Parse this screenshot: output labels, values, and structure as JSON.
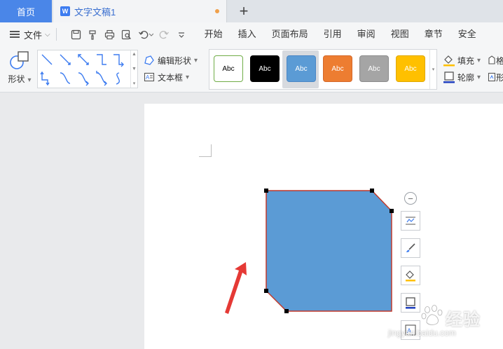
{
  "tabs": {
    "home_label": "首页",
    "doc_icon_letter": "W",
    "doc_title": "文字文稿1",
    "add_tab_symbol": "+"
  },
  "menu": {
    "file_label": "文件",
    "ribbon_tabs": [
      "开始",
      "插入",
      "页面布局",
      "引用",
      "审阅",
      "视图",
      "章节",
      "安全"
    ]
  },
  "ribbon": {
    "shape_label": "形状",
    "edit_shape_label": "编辑形状",
    "text_box_label": "文本框",
    "style_samples": [
      {
        "text": "Abc",
        "bg": "#ffffff",
        "border": "#70ad47",
        "fg": "#000000"
      },
      {
        "text": "Abc",
        "bg": "#000000",
        "border": "#000000",
        "fg": "#ffffff"
      },
      {
        "text": "Abc",
        "bg": "#5b9bd5",
        "border": "#4a86c5",
        "fg": "#ffffff"
      },
      {
        "text": "Abc",
        "bg": "#ed7d31",
        "border": "#d4682a",
        "fg": "#ffffff"
      },
      {
        "text": "Abc",
        "bg": "#a5a5a5",
        "border": "#8c8c8c",
        "fg": "#ffffff"
      },
      {
        "text": "Abc",
        "bg": "#ffc000",
        "border": "#e0a800",
        "fg": "#ffffff"
      }
    ],
    "fill_label": "填充",
    "outline_label": "轮廓",
    "extra_1": "格",
    "extra_2": "形"
  },
  "colors": {
    "accent": "#4a86e8",
    "shape_fill": "#5b9bd5",
    "shape_outline": "#c0392b",
    "arrow": "#e53935"
  },
  "watermark": {
    "text": "经验",
    "url": "jingyan.baidu.com"
  }
}
